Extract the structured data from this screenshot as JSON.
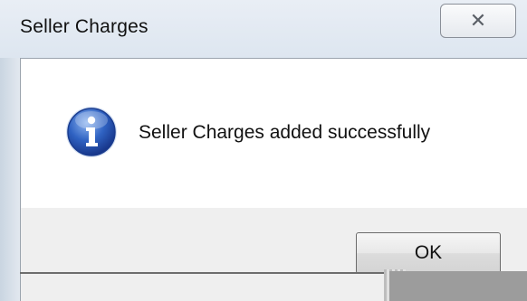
{
  "window": {
    "title": "Seller Charges",
    "close_glyph": "✕"
  },
  "message": {
    "icon": "information-icon",
    "text": "Seller Charges added successfully"
  },
  "buttons": {
    "ok_label": "OK"
  },
  "colors": {
    "icon_blue": "#2a5db8",
    "title_bar": "#e3eaf2",
    "content_bg": "#ffffff",
    "button_area_bg": "#efefef"
  }
}
